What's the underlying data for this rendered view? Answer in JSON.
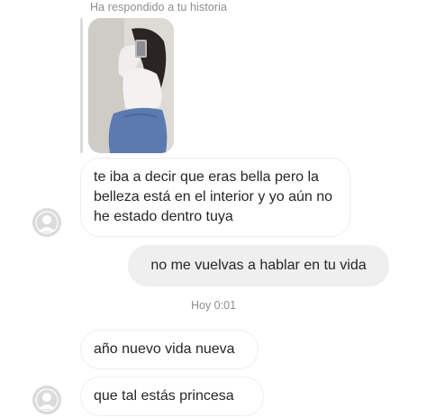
{
  "story_reply": {
    "caption": "Ha respondido a tu historia",
    "thumbnail": "story-photo"
  },
  "messages": [
    {
      "from": "other",
      "text": "te iba a decir que eras bella pero la belleza está en el interior y yo aún no he estado dentro tuya"
    },
    {
      "from": "me",
      "text": "no me vuelvas a hablar en tu vida"
    }
  ],
  "separator": {
    "time": "Hoy 0:01"
  },
  "messages_after": [
    {
      "from": "other",
      "text": "año nuevo vida nueva"
    },
    {
      "from": "other",
      "text": "que tal estás princesa"
    }
  ],
  "colors": {
    "background": "#ffffff",
    "sent_bubble": "#efefef",
    "received_border": "#efefef",
    "meta_text": "#8e8e8e",
    "avatar": "#dbdbdb"
  },
  "icons": {
    "avatar": "default-avatar-icon"
  }
}
